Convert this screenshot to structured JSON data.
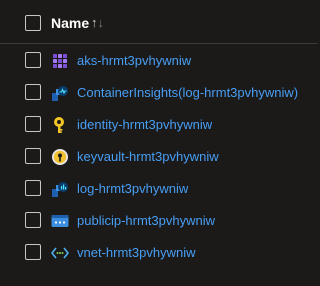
{
  "header": {
    "name_label": "Name",
    "sort_icon": "sort-ascending-icon"
  },
  "rows": [
    {
      "label": "aks-hrmt3pvhywniw",
      "icon": "kubernetes-icon"
    },
    {
      "label": "ContainerInsights(log-hrmt3pvhywniw)",
      "icon": "container-insights-icon"
    },
    {
      "label": "identity-hrmt3pvhywniw",
      "icon": "managed-identity-icon"
    },
    {
      "label": "keyvault-hrmt3pvhywniw",
      "icon": "key-vault-icon"
    },
    {
      "label": "log-hrmt3pvhywniw",
      "icon": "log-analytics-icon"
    },
    {
      "label": "publicip-hrmt3pvhywniw",
      "icon": "public-ip-icon"
    },
    {
      "label": "vnet-hrmt3pvhywniw",
      "icon": "virtual-network-icon"
    }
  ],
  "colors": {
    "background": "#1b1a19",
    "link": "#479ef5",
    "header_text": "#ffffff",
    "divider": "#3b3a39"
  }
}
